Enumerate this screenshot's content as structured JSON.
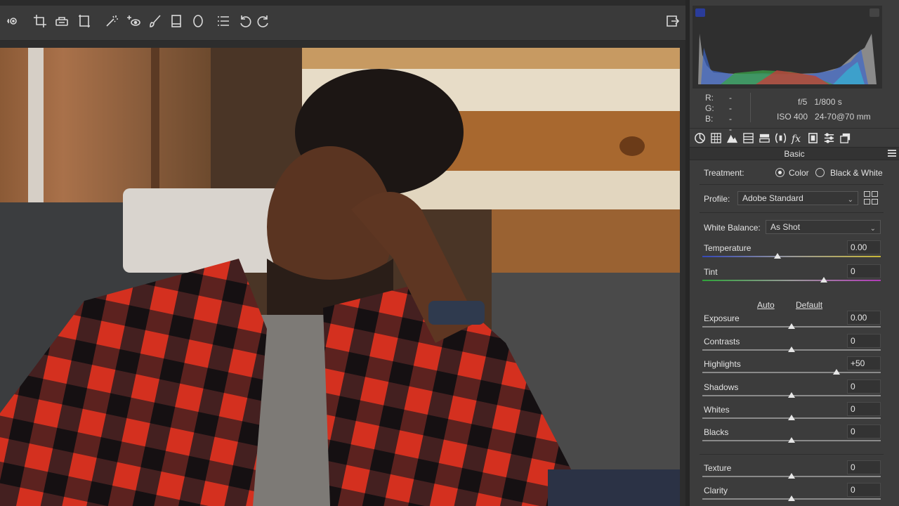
{
  "panel": {
    "info": {
      "r_label": "R:",
      "g_label": "G:",
      "b_label": "B:",
      "r": "----",
      "g": "----",
      "b": "----",
      "aperture": "f/5",
      "shutter": "1/800 s",
      "iso": "ISO 400",
      "lens": "24-70@70 mm"
    },
    "section_title": "Basic",
    "treatment": {
      "label": "Treatment:",
      "options": [
        "Color",
        "Black & White"
      ],
      "selected": "Color"
    },
    "profile": {
      "label": "Profile:",
      "value": "Adobe Standard"
    },
    "white_balance": {
      "label": "White Balance:",
      "value": "As Shot"
    },
    "auto_label": "Auto",
    "default_label": "Default",
    "sliders": [
      {
        "label": "Temperature",
        "value": "0.00",
        "position": 0.42
      },
      {
        "label": "Tint",
        "value": "0",
        "position": 0.68
      },
      {
        "label": "Exposure",
        "value": "0.00",
        "position": 0.5
      },
      {
        "label": "Contrasts",
        "value": "0",
        "position": 0.5
      },
      {
        "label": "Highlights",
        "value": "+50",
        "position": 0.75
      },
      {
        "label": "Shadows",
        "value": "0",
        "position": 0.5
      },
      {
        "label": "Whites",
        "value": "0",
        "position": 0.5
      },
      {
        "label": "Blacks",
        "value": "0",
        "position": 0.5
      },
      {
        "label": "Texture",
        "value": "0",
        "position": 0.5
      },
      {
        "label": "Clarity",
        "value": "0",
        "position": 0.5
      }
    ]
  },
  "toolbar": {
    "icons": [
      "targeted-adjust-icon",
      "crop-icon",
      "spot-removal-icon",
      "transform-icon",
      "healing-brush-icon",
      "red-eye-icon",
      "adjustment-brush-icon",
      "graduated-filter-icon",
      "radial-filter-icon",
      "list-icon",
      "rotate-left-icon",
      "rotate-right-icon",
      "export-icon"
    ]
  },
  "panel_tabs": [
    "basic-icon",
    "tone-curve-icon",
    "detail-icon",
    "hsl-icon",
    "split-toning-icon",
    "lens-corrections-icon",
    "effects-icon",
    "calibration-icon",
    "presets-icon",
    "snapshots-icon"
  ],
  "colors": {
    "accent": "#e6e6e6",
    "panel_bg": "#3c3c3c",
    "toolbar_bg": "#3a3a3a"
  }
}
